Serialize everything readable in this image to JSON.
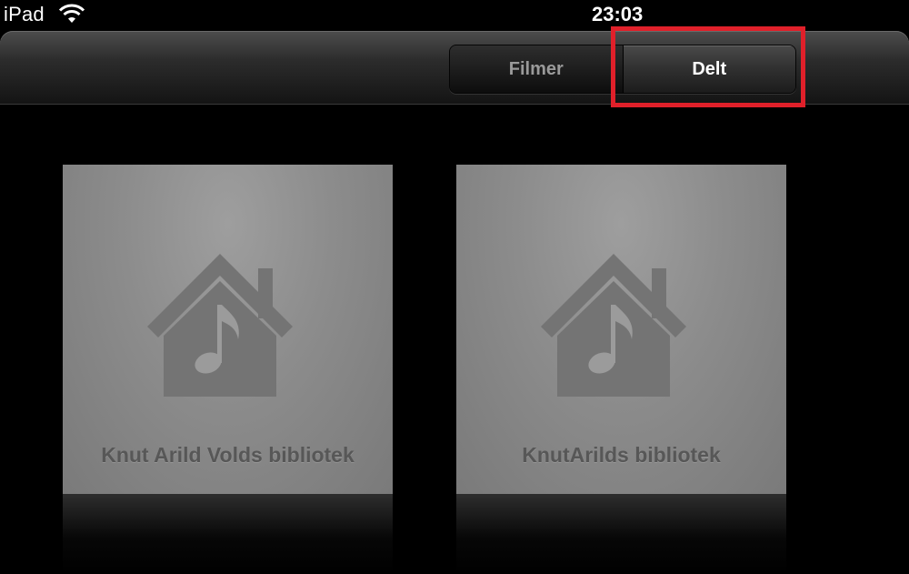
{
  "status_bar": {
    "device": "iPad",
    "wifi_icon": "wifi-icon",
    "time": "23:03"
  },
  "toolbar": {
    "segments": [
      {
        "label": "Filmer",
        "selected": false
      },
      {
        "label": "Delt",
        "selected": true
      }
    ]
  },
  "libraries": [
    {
      "name": "Knut Arild Volds bibliotek",
      "icon": "home-sharing-music-icon"
    },
    {
      "name": "KnutArilds bibliotek",
      "icon": "home-sharing-music-icon"
    }
  ],
  "colors": {
    "highlight": "#e0202a",
    "tile": "#8c8c8c",
    "tile_text": "#575757"
  }
}
